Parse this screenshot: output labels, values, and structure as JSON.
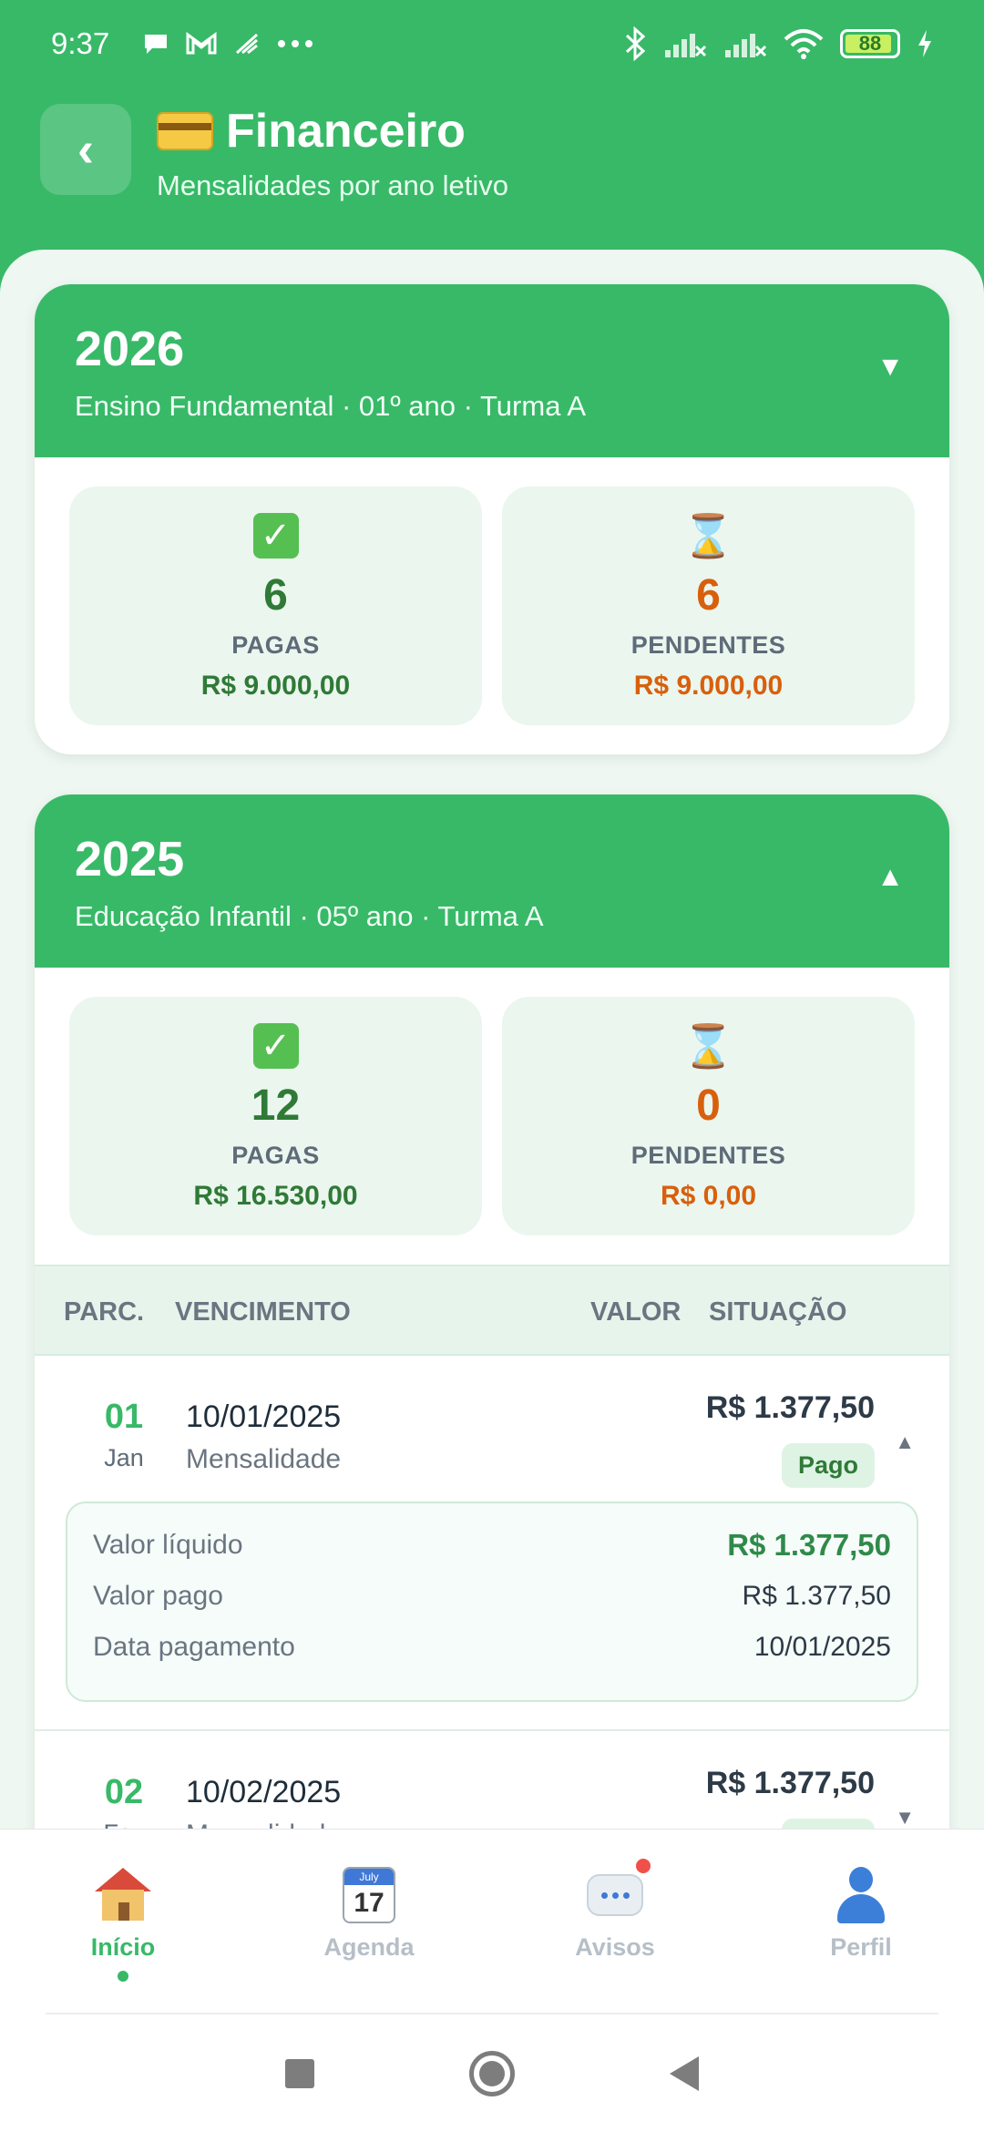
{
  "status_bar": {
    "time": "9:37",
    "battery": "88"
  },
  "header": {
    "title": "Financeiro",
    "subtitle": "Mensalidades por ano letivo",
    "back_symbol": "‹"
  },
  "years": [
    {
      "year": "2026",
      "course": "Ensino Fundamental · 01º ano · Turma A",
      "expanded_indicator": "▼",
      "paid": {
        "count": "6",
        "label": "PAGAS",
        "amount": "R$ 9.000,00"
      },
      "pending": {
        "count": "6",
        "label": "PENDENTES",
        "amount": "R$ 9.000,00"
      }
    },
    {
      "year": "2025",
      "course": "Educação Infantil · 05º ano · Turma A",
      "expanded_indicator": "▲",
      "paid": {
        "count": "12",
        "label": "PAGAS",
        "amount": "R$ 16.530,00"
      },
      "pending": {
        "count": "0",
        "label": "PENDENTES",
        "amount": "R$ 0,00"
      },
      "table": {
        "headers": {
          "parc": "PARC.",
          "vencimento": "VENCIMENTO",
          "valor": "VALOR",
          "situacao": "SITUAÇÃO"
        },
        "rows": [
          {
            "num": "01",
            "month": "Jan",
            "date": "10/01/2025",
            "type": "Mensalidade",
            "value": "R$ 1.377,50",
            "status": "Pago",
            "chevron": "▲",
            "details": {
              "net_label": "Valor líquido",
              "net_value": "R$ 1.377,50",
              "paid_label": "Valor pago",
              "paid_value": "R$ 1.377,50",
              "date_label": "Data pagamento",
              "date_value": "10/01/2025"
            }
          },
          {
            "num": "02",
            "month": "Fev",
            "date": "10/02/2025",
            "type": "Mensalidade",
            "value": "R$ 1.377,50",
            "status": "Pago",
            "chevron": "▼"
          }
        ]
      }
    }
  ],
  "bottom_nav": [
    {
      "label": "Início",
      "icon": "house-icon",
      "active": true
    },
    {
      "label": "Agenda",
      "icon": "calendar-icon",
      "calendar_month": "July",
      "calendar_day": "17"
    },
    {
      "label": "Avisos",
      "icon": "chat-bubble-icon",
      "has_notification": true
    },
    {
      "label": "Perfil",
      "icon": "person-icon"
    }
  ]
}
